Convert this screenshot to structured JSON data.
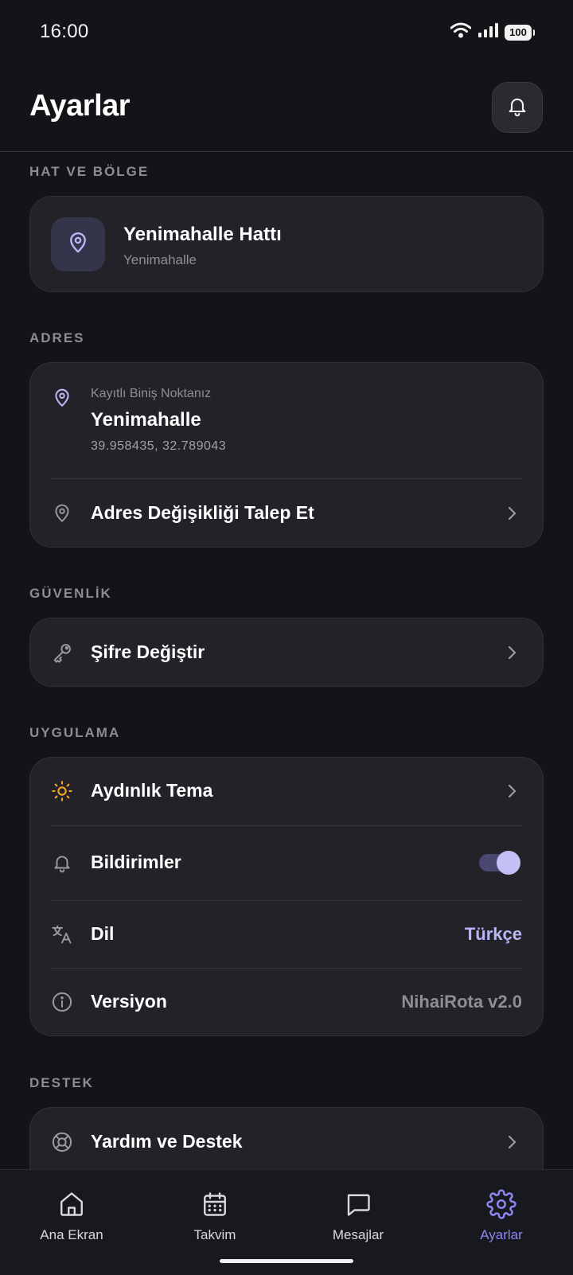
{
  "status_bar": {
    "time": "16:00",
    "battery": "100"
  },
  "header": {
    "title": "Ayarlar"
  },
  "sections": {
    "line": {
      "title": "HAT VE BÖLGE",
      "name": "Yenimahalle Hattı",
      "region": "Yenimahalle"
    },
    "address": {
      "title": "ADRES",
      "caption": "Kayıtlı Biniş Noktanız",
      "name": "Yenimahalle",
      "coords": "39.958435, 32.789043",
      "change_label": "Adres Değişikliği Talep Et"
    },
    "security": {
      "title": "GÜVENLİK",
      "password_label": "Şifre Değiştir"
    },
    "app": {
      "title": "UYGULAMA",
      "theme_label": "Aydınlık Tema",
      "notifications_label": "Bildirimler",
      "notifications_enabled": true,
      "language_label": "Dil",
      "language_value": "Türkçe",
      "version_label": "Versiyon",
      "version_value": "NihaiRota v2.0"
    },
    "support": {
      "title": "DESTEK",
      "help_label": "Yardım ve Destek"
    }
  },
  "bottom_nav": {
    "items": [
      {
        "label": "Ana Ekran",
        "icon": "home-icon",
        "active": false
      },
      {
        "label": "Takvim",
        "icon": "calendar-icon",
        "active": false
      },
      {
        "label": "Mesajlar",
        "icon": "message-icon",
        "active": false
      },
      {
        "label": "Ayarlar",
        "icon": "gear-icon",
        "active": true
      }
    ]
  },
  "colors": {
    "accent": "#8b86f2",
    "accent_light": "#b9b6f7",
    "sun": "#f5a623",
    "background": "#131318",
    "card": "#222228"
  }
}
